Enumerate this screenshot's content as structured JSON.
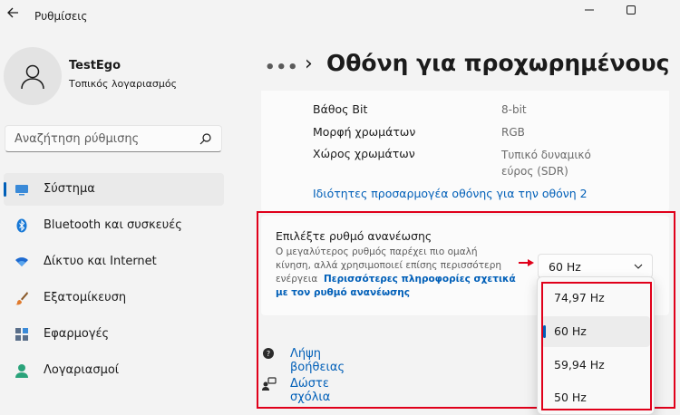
{
  "app": {
    "title": "Ρυθμίσεις"
  },
  "window_controls": {
    "minimize": "minimize-icon",
    "maximize": "maximize-icon"
  },
  "profile": {
    "name": "TestEgo",
    "account_type": "Τοπικός λογαριασμός"
  },
  "search": {
    "placeholder": "Αναζήτηση ρύθμισης"
  },
  "sidebar": {
    "items": [
      {
        "label": "Σύστημα",
        "icon": "system-icon",
        "active": true
      },
      {
        "label": "Bluetooth και συσκευές",
        "icon": "bluetooth-icon"
      },
      {
        "label": "Δίκτυο και Internet",
        "icon": "wifi-icon"
      },
      {
        "label": "Εξατομίκευση",
        "icon": "brush-icon"
      },
      {
        "label": "Εφαρμογές",
        "icon": "apps-icon"
      },
      {
        "label": "Λογαριασμοί",
        "icon": "account-icon"
      }
    ]
  },
  "header": {
    "breadcrumb_dots": "•••",
    "chevron": "›",
    "title": "Οθόνη για προχωρημένους"
  },
  "display_info": {
    "rows": [
      {
        "label": "Βάθος Bit",
        "value": "8-bit"
      },
      {
        "label": "Μορφή χρωμάτων",
        "value": "RGB"
      },
      {
        "label": "Χώρος χρωμάτων",
        "value_line1": "Τυπικό δυναμικό",
        "value_line2": "εύρος (SDR)"
      }
    ],
    "adapter_link": "Ιδιότητες προσαρμογέα οθόνης για την οθόνη 2"
  },
  "refresh_rate": {
    "title": "Επιλέξτε ρυθμό ανανέωσης",
    "desc_line1": "Ο μεγαλύτερος ρυθμός παρέχει πιο ομαλή",
    "desc_line2": "κίνηση, αλλά χρησιμοποιεί επίσης περισσότερη",
    "desc_line3": "ενέργεια",
    "more_info_line1": "Περισσότερες πληροφορίες σχετικά",
    "more_info_line2": "με τον ρυθμό ανανέωσης",
    "selected": "60 Hz",
    "options": [
      "74,97 Hz",
      "60 Hz",
      "59,94 Hz",
      "50 Hz"
    ],
    "selected_index": 1
  },
  "footer": {
    "help": "Λήψη βοήθειας",
    "feedback": "Δώστε σχόλια"
  },
  "colors": {
    "accent": "#005fb8",
    "highlight": "#e0001a",
    "background": "#f3f3f3"
  }
}
